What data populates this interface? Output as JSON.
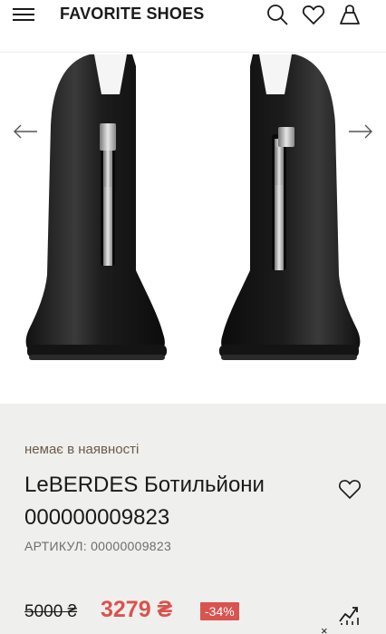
{
  "header": {
    "brand": "FAVORITE SHOES",
    "icons": {
      "menu": "hamburger-menu-icon",
      "search": "search-icon",
      "wishlist": "heart-icon",
      "cart": "bag-icon"
    }
  },
  "gallery": {
    "prev_icon": "arrow-left-icon",
    "next_icon": "arrow-right-icon",
    "image": "black leather ankle boots with front zipper"
  },
  "product": {
    "availability": "немає в наявності",
    "title": "LeBERDES Ботильйони 000000009823",
    "sku_label": "АРТИКУЛ:",
    "sku_value": "00000009823",
    "old_price": "5000 ₴",
    "new_price": "3279 ₴",
    "discount": "-34%",
    "wishlist_icon": "heart-outline-icon",
    "price_trend_icon": "price-trend-icon",
    "close_symbol": "×"
  },
  "colors": {
    "accent_red": "#d9534f",
    "availability_text": "#6b5a4b",
    "info_background": "#efefed"
  }
}
